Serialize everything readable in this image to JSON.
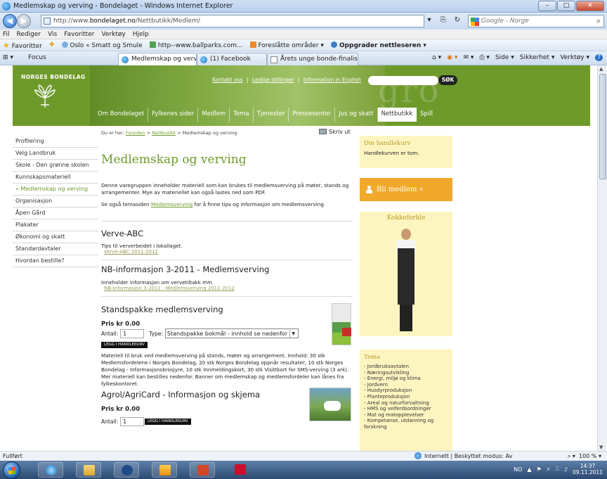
{
  "window": {
    "title": "Medlemskap og verving - Bondelaget - Windows Internet Explorer",
    "min": "–",
    "max": "□",
    "close": "✕"
  },
  "address": {
    "url_prefix": "http://www.",
    "url_domain": "bondelaget.no",
    "url_path": "/Nettbutikk/Medlem/",
    "search_placeholder": "Google - Norge"
  },
  "menubar": [
    "Fil",
    "Rediger",
    "Vis",
    "Favoritter",
    "Verktøy",
    "Hjelp"
  ],
  "favorites": {
    "label": "Favoritter",
    "items": [
      "Oslo « Smatt og Smule",
      "http--www.ballparks.com...",
      "Foreslåtte områder ▾",
      "Oppgrader nettleseren ▾"
    ]
  },
  "tabs": {
    "focus": "Focus",
    "items": [
      "Medlemskap og vervin...",
      "(1) Facebook",
      "Årets unge bonde-finalist: ..."
    ],
    "close": "✕"
  },
  "commandbar": [
    "Side ▾",
    "Sikkerhet ▾",
    "Verktøy ▾",
    "?"
  ],
  "site": {
    "logo": "NORGES BONDELAG",
    "toplinks": [
      "Kontakt oss",
      "Ledige stillinger",
      "Information in English"
    ],
    "toplinks_sep": "|",
    "search_button": "SØK",
    "watermark": "gro",
    "mainnav": [
      "Om Bondelaget",
      "Fylkenes sider",
      "Medlem",
      "Tema",
      "Tjenester",
      "Pressesenter",
      "Jus og skatt",
      "Nettbutikk",
      "Spill"
    ]
  },
  "leftnav": [
    "Profilering",
    "Velg Landbruk",
    "Skole - Den grønne skolen",
    "Kunnskapsmateriell",
    "» Medlemskap og verving",
    "Organisasjon",
    "Åpen Gård",
    "Plakater",
    "Økonomi og skatt",
    "Standardavtaler",
    "Hvordan bestille?"
  ],
  "content": {
    "crumb_prefix": "Du er her:",
    "crumb_links": [
      "Forsiden",
      "Nettbutikk"
    ],
    "crumb_current": "Medlemskap og verving",
    "crumb_sep": ">",
    "print": "Skriv ut",
    "title": "Medlemskap og verving",
    "intro": "Denne varegruppen inneholder materiell som kan brukes til medlemsverving på møter, stands og arrangementer. Mye av materiellet kan også lastes ned som PDF.",
    "seealso_pre": "Se også temasiden",
    "seealso_link": "Medlemsverving",
    "seealso_post": "for å finne tips og informasjon om medlemsverving",
    "verve_title": "Verve-ABC",
    "verve_text": "Tips til ververbeidet i lokallaget.",
    "verve_link": "Verve-ABC 2011-2012",
    "nb_title": "NB-informasjon 3-2011 - Medlemsverving",
    "nb_text": "Inneholder informasjon om vervetiltakk mm",
    "nb_link": "NB-informasjon 3-2011 - Medlemsverving 2011-2012",
    "p1_title": "Standspakke medlemsverving",
    "p1_price": "Pris kr 0.00",
    "qty_label": "Antall:",
    "p1_qty": "1",
    "type_label": "Type:",
    "p1_type": "Standspakke bokmål - innhold se nedenfor",
    "cart_button": "LEGG I HANDLEKURV",
    "p1_desc": "Materiell til bruk ved medlemsverving på stands, møter og arrangement. Innhold: 30 stk Medlemsfordelene i Norges Bondelag, 20 stk Norges Bondelag oppnår resultater, 10 stk Norges Bondelag - Informasjonsbrosjyre, 10 stk Innmeldingskort, 30 stk Visittkort for SMS-verving (3 ark). Mer materiell kan bestilles nedenfor. Banner om medlemskap og medlemsfordeler kan lånes fra fylkeskontoret.",
    "p2_title": "Agrol/AgriCard - Informasjon og skjema",
    "p2_price": "Pris kr 0.00",
    "p2_qty": "1"
  },
  "right": {
    "cart_title": "Din handlekurv",
    "cart_text": "Handlekurven er tom.",
    "member": "Bli medlem »",
    "chef_title": "Kokkeforkle",
    "tema_title": "Tema",
    "tema_items": [
      "Jordbruksavtalen",
      "Næringsutvikling",
      "Energi, miljø og klima",
      "Jordvern",
      "Husdyrproduksjon",
      "Planteproduksjon",
      "Areal og naturforvaltning",
      "HMS og velferdsordninger",
      "Mat og matopplevelser",
      "Kompetanse, utdanning og forskning"
    ]
  },
  "status": {
    "left": "Fullført",
    "zone": "Internett | Beskyttet modus: Av",
    "zoom": "100 %"
  },
  "taskbar": {
    "lang": "NO",
    "time": "14:37",
    "date": "09.11.2011"
  },
  "colors": {
    "brand_green": "#6e9a2c",
    "sidebar_yellow": "#fdf5c0",
    "member_orange": "#f0a92a"
  }
}
